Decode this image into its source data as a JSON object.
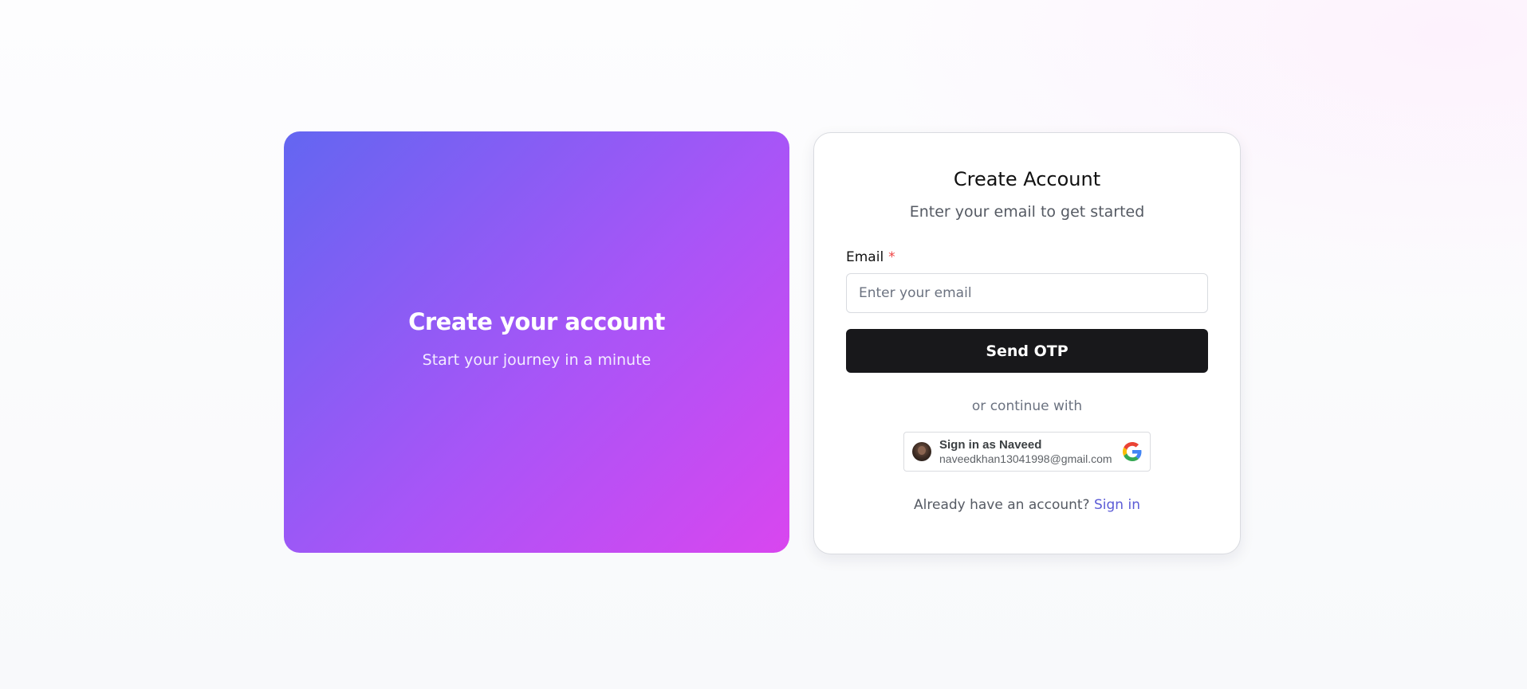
{
  "hero": {
    "title": "Create your account",
    "subtitle": "Start your journey in a minute",
    "gradient_start": "#6366f1",
    "gradient_end": "#d946ef"
  },
  "form": {
    "title": "Create Account",
    "subtitle": "Enter your email to get started",
    "email_label": "Email",
    "required_mark": "*",
    "email_placeholder": "Enter your email",
    "email_value": "",
    "submit_label": "Send OTP",
    "divider_text": "or continue with",
    "google": {
      "name_line": "Sign in as Naveed",
      "email_line": "naveedkhan13041998@gmail.com",
      "icon": "google-icon"
    },
    "footer_prefix": "Already have an account?",
    "footer_link": "Sign in",
    "accent_color": "#5b5bd6",
    "button_color": "#18181b"
  }
}
